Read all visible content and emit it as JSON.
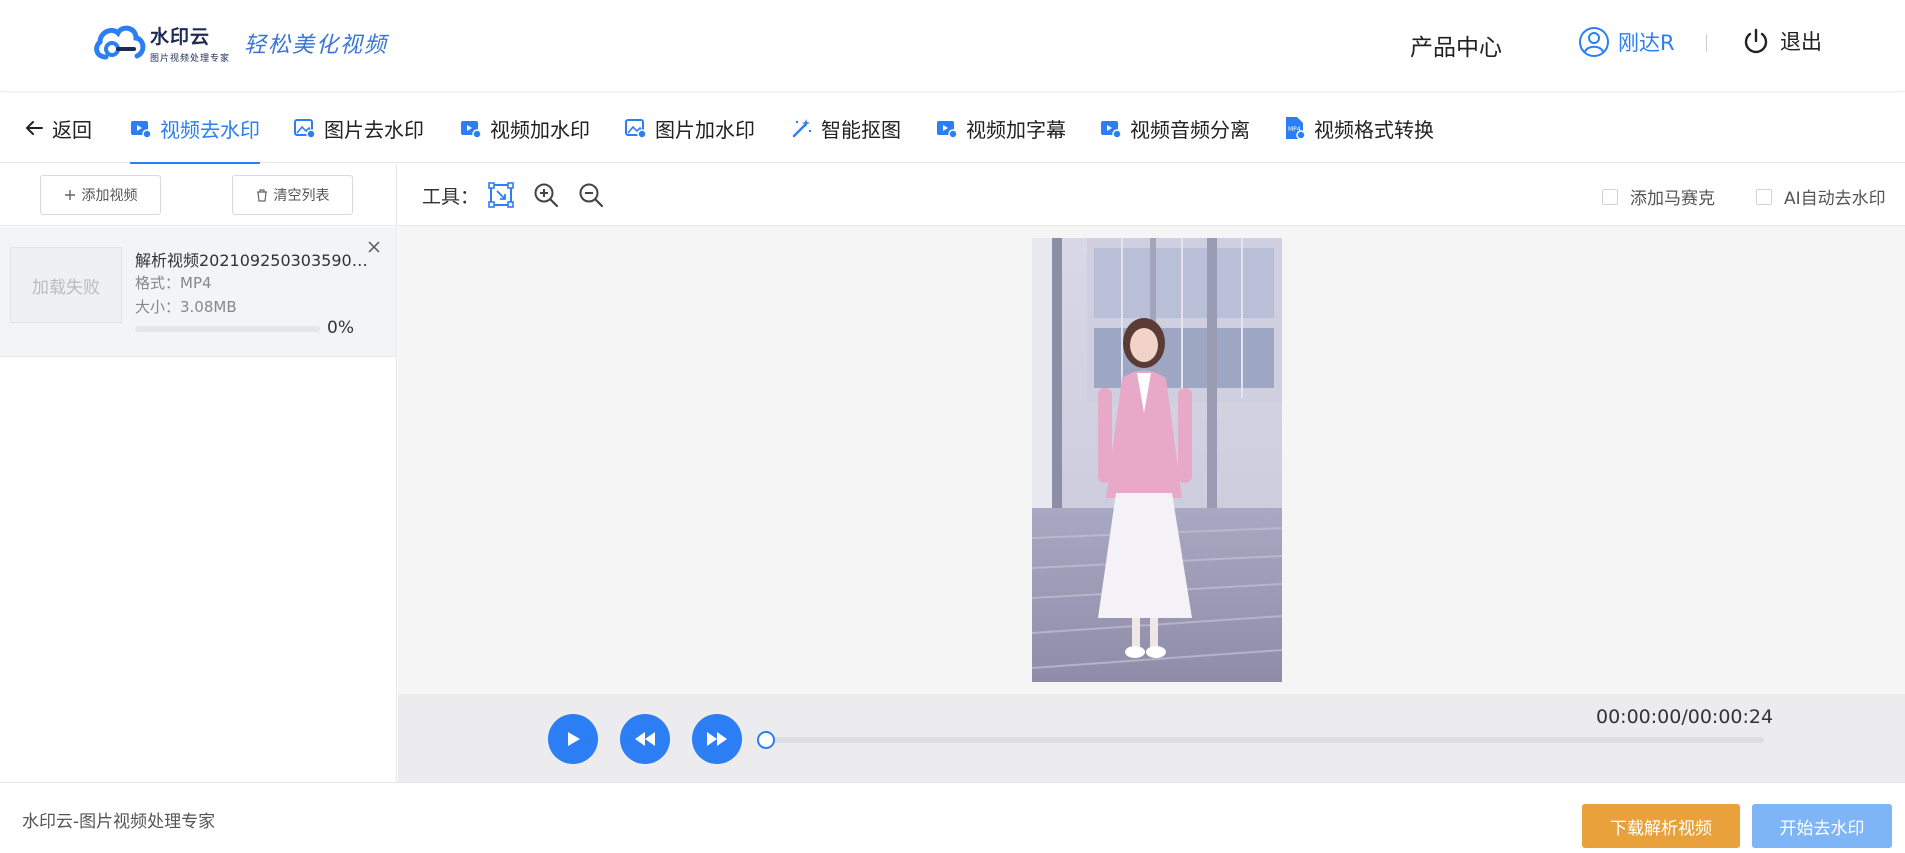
{
  "header": {
    "logo_name": "水印云",
    "logo_sub": "图片视频处理专家",
    "slogan": "轻松美化视频",
    "product_center": "产品中心",
    "user_name": "刚达R",
    "logout": "退出"
  },
  "tabs": {
    "back": "返回",
    "items": [
      {
        "label": "视频去水印",
        "icon": "video-icon",
        "active": true
      },
      {
        "label": "图片去水印",
        "icon": "image-icon"
      },
      {
        "label": "视频加水印",
        "icon": "video-add-icon"
      },
      {
        "label": "图片加水印",
        "icon": "image-add-icon"
      },
      {
        "label": "智能抠图",
        "icon": "magic-wand-icon"
      },
      {
        "label": "视频加字幕",
        "icon": "video-subtitle-icon"
      },
      {
        "label": "视频音频分离",
        "icon": "video-audio-icon"
      },
      {
        "label": "视频格式转换",
        "icon": "mp4-file-icon"
      }
    ]
  },
  "left_panel": {
    "add_video": "添加视频",
    "clear_list": "清空列表",
    "file": {
      "thumb_text": "加载失败",
      "name": "解析视频20210925030359003...",
      "format": "格式：MP4",
      "size": "大小：3.08MB",
      "progress_text": "0%",
      "progress": 0
    }
  },
  "tools": {
    "label": "工具：",
    "add_mosaic": "添加马赛克",
    "ai_remove": "AI自动去水印"
  },
  "player": {
    "time": "00:00:00/00:00:24"
  },
  "footer": {
    "text": "水印云-图片视频处理专家",
    "download": "下载解析视频",
    "start": "开始去水印"
  },
  "colors": {
    "accent": "#2b7ef3",
    "download_button": "#e9a23b",
    "start_button": "#7db5f7"
  }
}
